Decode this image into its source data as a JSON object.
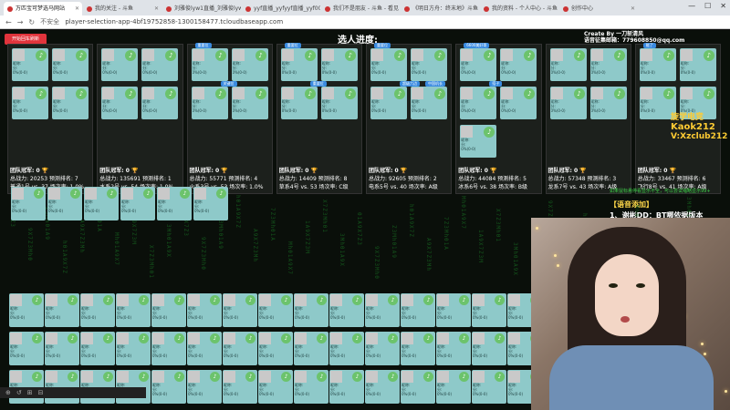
{
  "browser": {
    "tabs": [
      {
        "label": "万匹宝可梦选马网站",
        "active": true
      },
      {
        "label": "我的关注 - 斗鱼"
      },
      {
        "label": "刘雅俊lyw1直播_刘雅俊lyw"
      },
      {
        "label": "yyf直播_yyfyyf直播_yyf00TJ"
      },
      {
        "label": "我们不是朋友 - 斗鱼 - 看见"
      },
      {
        "label": "《明日方舟：终末地》斗鱼"
      },
      {
        "label": "我的资料 - 个人中心 - 斗鱼"
      },
      {
        "label": "创作中心"
      }
    ],
    "url_prefix": "不安全",
    "url": "player-selection-app-4bf19752858-1300158477.tcloudbaseapp.com"
  },
  "game": {
    "red_button": "开始回车刷新",
    "title": "选人进度:",
    "creator_line1": "Create By 一刀斩清风",
    "creator_line2": "语音征集邮箱：779608850@qq.com",
    "side_note": "如果鼠标悬停看显示不全，可以尝试缩略显示99+",
    "voice_title": "【语音添加】",
    "voice_item": "1、谢彬DD：BT哪依据版本",
    "logo": {
      "line1": "旋学电竞",
      "line2": "Kaok212",
      "line3": "V:Xzclub212"
    }
  },
  "teams": [
    {
      "badges": [],
      "stats": [
        "团队冠军: 0 🏆",
        "总战力: 20253 预测排名: 7",
        "普通1号 vs. 37 场次率: 1.0%"
      ]
    },
    {
      "badges": [],
      "stats": [
        "团队冠军: 0 🏆",
        "总战力: 135691 预测排名: 1",
        "水系2号 vs. 54 场次率: 1.0%"
      ]
    },
    {
      "badges": [
        "重要位",
        "关键位"
      ],
      "stats": [
        "团队冠军: 0 🏆",
        "总战力: 55771 预测排名: 4",
        "火系3号 vs. 53 场次率: 1.0%"
      ]
    },
    {
      "badges": [
        "重要位",
        "重要位"
      ],
      "stats": [
        "团队冠军: 0 🏆",
        "总战力: 14409 预测排名: 8",
        "草系4号 vs. 53 场次率: C级"
      ]
    },
    {
      "badges": [
        "重要位",
        "超级六边",
        "中国机长"
      ],
      "stats": [
        "团队冠军: 0 🏆",
        "总战力: 92605 预测排名: 2",
        "电系5号 vs. 40 场次率: A级"
      ]
    },
    {
      "badges": [
        "6600美好哥",
        "搭子"
      ],
      "stats": [
        "团队冠军: 0 🏆",
        "总战力: 44084 预测排名: 5",
        "冰系6号 vs. 38 场次率: B级"
      ]
    },
    {
      "badges": [],
      "stats": [
        "团队冠军: 0 🏆",
        "总战力: 57348 预测排名: 3",
        "龙系7号 vs. 43 场次率: A级"
      ]
    },
    {
      "badges": [
        "能了"
      ],
      "stats": [
        "团队冠军: 0 🏆",
        "总战力: 33467 预测排名: 6",
        "飞行8号 vs. 41 场次率: A级"
      ]
    }
  ],
  "slot_text": {
    "nick": "昵称:",
    "score": "分:",
    "rate": "0%(0-0)"
  },
  "bottom_bar": [
    "⊕",
    "↺",
    "⊞",
    "⊟"
  ]
}
